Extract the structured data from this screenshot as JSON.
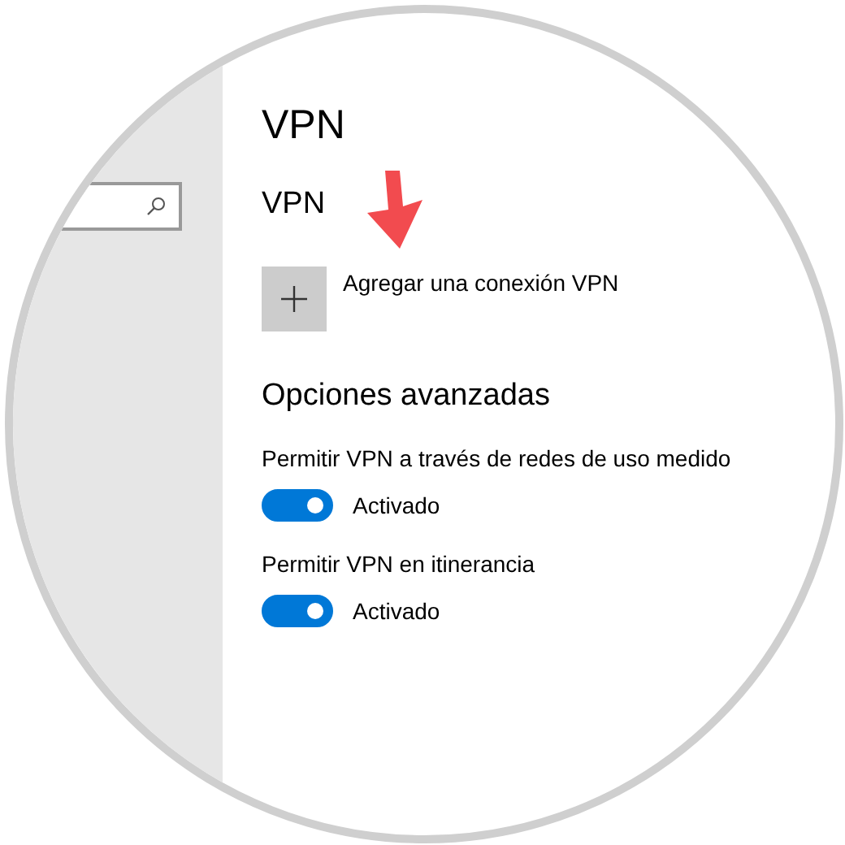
{
  "page": {
    "title": "VPN",
    "section": "VPN",
    "add_button": "Agregar una conexión VPN"
  },
  "advanced": {
    "heading": "Opciones avanzadas",
    "options": [
      {
        "label": "Permitir VPN a través de redes de uso medido",
        "on": true,
        "state": "Activado"
      },
      {
        "label": "Permitir VPN en itinerancia",
        "on": true,
        "state": "Activado"
      }
    ]
  }
}
